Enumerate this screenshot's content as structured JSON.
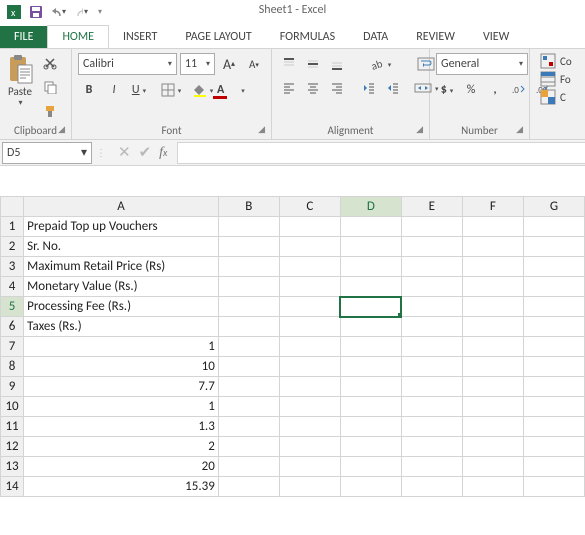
{
  "title": "Sheet1 - Excel",
  "tabs": {
    "file": "FILE",
    "home": "HOME",
    "insert": "INSERT",
    "pagelayout": "PAGE LAYOUT",
    "formulas": "FORMULAS",
    "data": "DATA",
    "review": "REVIEW",
    "view": "VIEW"
  },
  "groups": {
    "clipboard": "Clipboard",
    "font": "Font",
    "alignment": "Alignment",
    "number": "Number",
    "cells": "C"
  },
  "clipboard": {
    "paste": "Paste"
  },
  "font": {
    "name": "Calibri",
    "size": "11",
    "bold": "B",
    "italic": "I",
    "underline": "U",
    "biggerA": "A",
    "smallerA": "A"
  },
  "number": {
    "format": "General",
    "percent": "%",
    "comma": ",",
    "currency": "$"
  },
  "cells": {
    "cond": "Co",
    "fmt": "Fo",
    "styles": "C"
  },
  "namebox": "D5",
  "cols": [
    "A",
    "B",
    "C",
    "D",
    "E",
    "F",
    "G"
  ],
  "rows": [
    {
      "n": "1",
      "A": "Prepaid Top up Vouchers"
    },
    {
      "n": "2",
      "A": "Sr. No."
    },
    {
      "n": "3",
      "A": "Maximum Retail Price (Rs)"
    },
    {
      "n": "4",
      "A": "Monetary Value (Rs.)"
    },
    {
      "n": "5",
      "A": "Processing Fee (Rs.)"
    },
    {
      "n": "6",
      "A": "Taxes (Rs.)"
    },
    {
      "n": "7",
      "A": "1",
      "num": true
    },
    {
      "n": "8",
      "A": "10",
      "num": true
    },
    {
      "n": "9",
      "A": "7.7",
      "num": true
    },
    {
      "n": "10",
      "A": "1",
      "num": true
    },
    {
      "n": "11",
      "A": "1.3",
      "num": true
    },
    {
      "n": "12",
      "A": "2",
      "num": true
    },
    {
      "n": "13",
      "A": "20",
      "num": true
    },
    {
      "n": "14",
      "A": "15.39",
      "num": true
    }
  ],
  "active": {
    "row": "5",
    "col": "D"
  }
}
